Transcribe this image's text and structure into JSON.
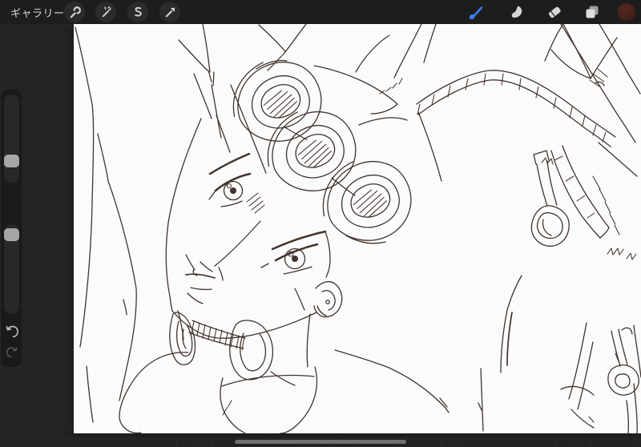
{
  "app": {
    "name_hint": "digital painting app canvas view"
  },
  "topbar": {
    "gallery_label": "ギャラリー",
    "left_tools": [
      {
        "id": "actions",
        "icon": "wrench-icon"
      },
      {
        "id": "adjustments",
        "icon": "magic-wand-icon"
      },
      {
        "id": "selection",
        "icon": "selection-s-icon"
      },
      {
        "id": "transform",
        "icon": "transform-arrow-icon"
      }
    ],
    "right_tools": [
      {
        "id": "paint",
        "icon": "paintbrush-icon",
        "active": true,
        "active_color": "#3b7cf0"
      },
      {
        "id": "smudge",
        "icon": "smudge-finger-icon",
        "active": false
      },
      {
        "id": "erase",
        "icon": "eraser-icon",
        "active": false
      },
      {
        "id": "layers",
        "icon": "layers-icon",
        "active": false
      },
      {
        "id": "color",
        "icon": "color-swatch-circle",
        "swatch_color": "#46211a"
      }
    ],
    "colors": {
      "bar_bg": "#1d1d1d",
      "button_bg": "#2b2b2b",
      "icon_gray": "#d2d2d2"
    }
  },
  "sidebar": {
    "controls": [
      {
        "id": "brush-size-slider",
        "handle_position": "upper"
      },
      {
        "id": "modify-button"
      },
      {
        "id": "opacity-slider",
        "handle_position": "top"
      },
      {
        "id": "undo-button",
        "icon": "undo-arrow-icon"
      },
      {
        "id": "redo-button",
        "icon": "redo-arrow-icon"
      }
    ],
    "colors": {
      "bar_bg": "#1a1a1a",
      "track": "#282828",
      "handle": "#a6a6a6"
    }
  },
  "canvas": {
    "background": "#fbfbfb",
    "line_color": "#41332d",
    "subject": "Monochrome line-art sketch: tilted portrait of a young man with three rosette hair curls on the forehead, large detailed eyes, braided hair locks, ring-shaped and teardrop earrings, winged collar and arm lines"
  },
  "home_indicator": {
    "color": "#707070"
  }
}
